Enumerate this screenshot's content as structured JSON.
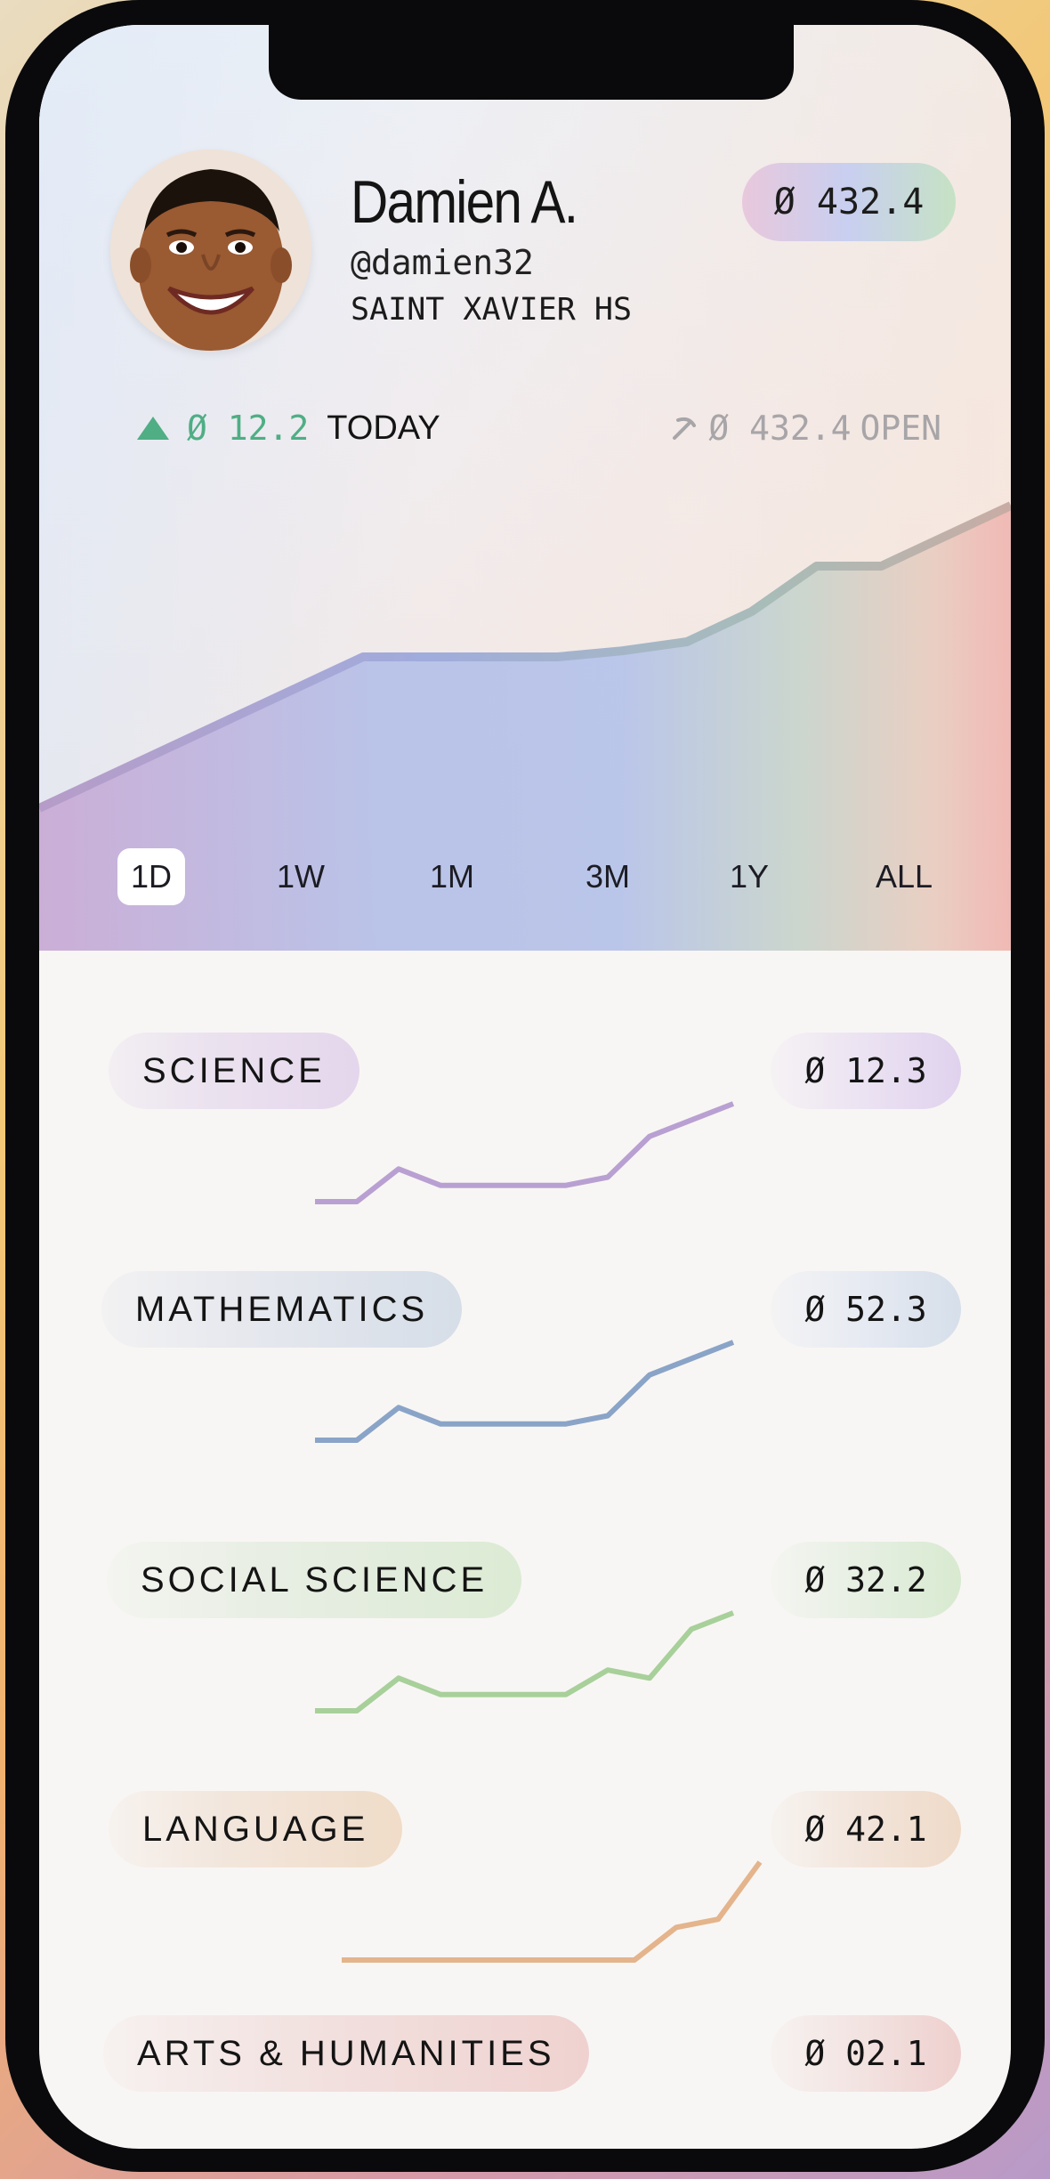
{
  "profile": {
    "name": "Damien A.",
    "handle": "@damien32",
    "school": "SAINT XAVIER HS",
    "balance": "Ø 432.4"
  },
  "stats": {
    "today_value": "Ø 12.2",
    "today_label": "TODAY",
    "open_value": "Ø 432.4",
    "open_label": "OPEN"
  },
  "chart_data": {
    "type": "area",
    "title": "",
    "xlabel": "",
    "ylabel": "",
    "series": [
      {
        "values": [
          0,
          1,
          2,
          3,
          4,
          5,
          5,
          5,
          5,
          5.2,
          5.5,
          6.5,
          8,
          8,
          9,
          10
        ]
      }
    ]
  },
  "tabs": [
    {
      "label": "1D",
      "active": true
    },
    {
      "label": "1W",
      "active": false
    },
    {
      "label": "1M",
      "active": false
    },
    {
      "label": "3M",
      "active": false
    },
    {
      "label": "1Y",
      "active": false
    },
    {
      "label": "ALL",
      "active": false
    }
  ],
  "subjects": [
    {
      "name": "SCIENCE",
      "value": "Ø 12.3",
      "color": "#b9a0d2",
      "trend": [
        0,
        0,
        2,
        1,
        1,
        1,
        1,
        1.5,
        4,
        5,
        6
      ]
    },
    {
      "name": "MATHEMATICS",
      "value": "Ø 52.3",
      "color": "#8aa4c8",
      "trend": [
        0,
        0,
        2,
        1,
        1,
        1,
        1,
        1.5,
        4,
        5,
        6
      ]
    },
    {
      "name": "SOCIAL SCIENCE",
      "value": "Ø 32.2",
      "color": "#a8d09a",
      "trend": [
        0,
        0,
        2,
        1,
        1,
        1,
        1,
        2.5,
        2,
        5,
        6
      ]
    },
    {
      "name": "LANGUAGE",
      "value": "Ø 42.1",
      "color": "#e4b48c",
      "trend": [
        0,
        0,
        0,
        0,
        0,
        0,
        0,
        0,
        2,
        2.5,
        6
      ]
    },
    {
      "name": "ARTS & HUMANITIES",
      "value": "Ø 02.1",
      "color": "#e6a2a2",
      "trend": []
    }
  ],
  "colors": {
    "positive": "#4fae84",
    "muted": "#a7a5a8"
  }
}
